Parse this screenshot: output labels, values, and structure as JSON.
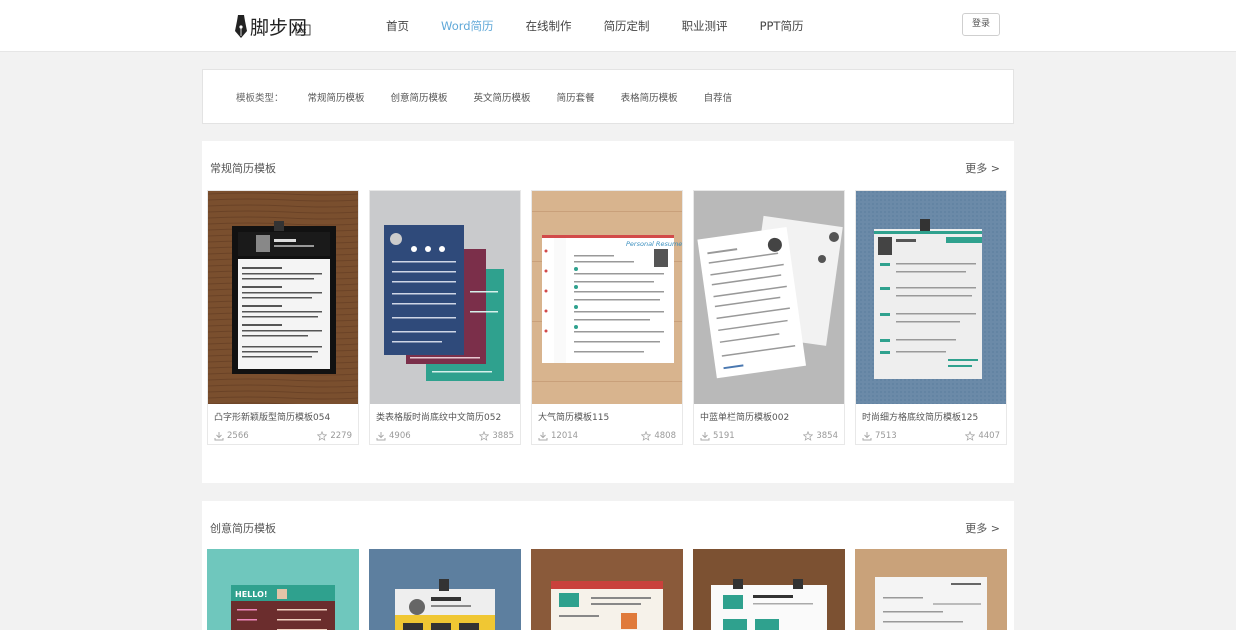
{
  "brand": {
    "logo_text": "脚步网",
    "logo_sub": "xx"
  },
  "nav": {
    "items": [
      {
        "label": "首页",
        "active": false
      },
      {
        "label": "Word简历",
        "active": true
      },
      {
        "label": "在线制作",
        "active": false
      },
      {
        "label": "简历定制",
        "active": false
      },
      {
        "label": "职业测评",
        "active": false
      },
      {
        "label": "PPT简历",
        "active": false
      }
    ],
    "login": "登录"
  },
  "filter": {
    "label": "模板类型：",
    "items": [
      "常规简历模板",
      "创意简历模板",
      "英文简历模板",
      "简历套餐",
      "表格简历模板",
      "自荐信"
    ]
  },
  "sections": [
    {
      "title": "常规简历模板",
      "more": "更多 >",
      "cards": [
        {
          "title": "凸字形新颖版型简历模板054",
          "downloads": "2566",
          "favorites": "2279",
          "bg": "#7a4f2e"
        },
        {
          "title": "类表格版时尚底纹中文简历052",
          "downloads": "4906",
          "favorites": "3885",
          "bg": "#c9cacc"
        },
        {
          "title": "大气简历模板115",
          "downloads": "12014",
          "favorites": "4808",
          "bg": "#d8b48e"
        },
        {
          "title": "中蓝单栏简历模板002",
          "downloads": "5191",
          "favorites": "3854",
          "bg": "#b9b9b9"
        },
        {
          "title": "时尚细方格底纹简历模板125",
          "downloads": "7513",
          "favorites": "4407",
          "bg": "#6b8aa8"
        }
      ]
    },
    {
      "title": "创意简历模板",
      "more": "更多 >",
      "cards": [
        {
          "bg": "#6fc7bd",
          "hello": "HELLO!"
        },
        {
          "bg": "#5d7f9f"
        },
        {
          "bg": "#8a5a3a"
        },
        {
          "bg": "#7c5132"
        },
        {
          "bg": "#c9a27a"
        }
      ]
    }
  ],
  "colors": {
    "accent": "#5fa8d8",
    "teal": "#2fa18e",
    "navy": "#2f4a7a",
    "maroon": "#7b2f4a"
  }
}
